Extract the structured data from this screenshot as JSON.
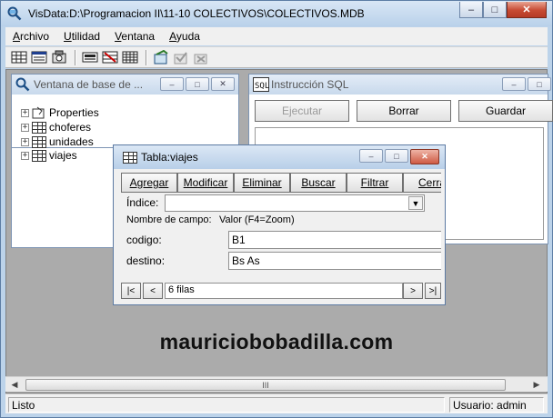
{
  "app": {
    "title": "VisData:D:\\Programacion II\\11-10 COLECTIVOS\\COLECTIVOS.MDB",
    "minimize": "–",
    "maximize": "□",
    "close": "✕"
  },
  "menubar": [
    {
      "accel": "A",
      "rest": "rchivo"
    },
    {
      "accel": "U",
      "rest": "tilidad"
    },
    {
      "accel": "V",
      "rest": "entana"
    },
    {
      "accel": "A",
      "rest": "yuda"
    }
  ],
  "database_window": {
    "title": "Ventana de base de ...",
    "items": [
      "Properties",
      "choferes",
      "unidades",
      "viajes"
    ]
  },
  "sql_window": {
    "title": "Instrucción SQL",
    "buttons": [
      "Ejecutar",
      "Borrar",
      "Guardar"
    ]
  },
  "table_window": {
    "title": "Tabla:viajes",
    "buttons": [
      "Agregar",
      "Modificar",
      "Eliminar",
      "Buscar",
      "Filtrar",
      "Cerra"
    ],
    "index_label": "Índice:",
    "index_value": "",
    "field_header": "Nombre de campo:",
    "value_header": "Valor (F4=Zoom)",
    "fields": [
      {
        "name": "codigo:",
        "value": "B1"
      },
      {
        "name": "destino:",
        "value": "Bs As"
      }
    ],
    "nav": {
      "first": "|<",
      "prev": "<",
      "record_text": "6 filas",
      "next": ">",
      "last": ">|"
    }
  },
  "watermark": "mauriciobobadilla.com",
  "scrollbar": {
    "thumb_glyph": "III"
  },
  "status": {
    "left": "Listo",
    "right": "Usuario: admin"
  },
  "colors": {
    "mdi_background": "#ababab",
    "frame": "#bcd3ea",
    "close_button": "#c74a33"
  }
}
